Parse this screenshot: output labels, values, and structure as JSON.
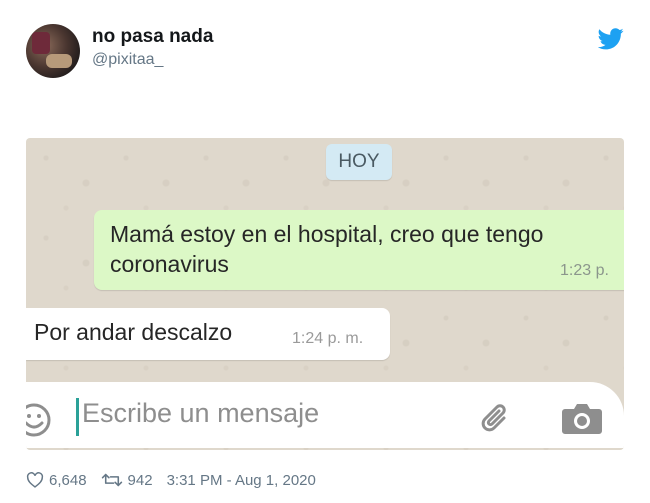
{
  "tweet": {
    "display_name": "no pasa nada",
    "handle": "@pixitaa_",
    "likes": "6,648",
    "retweets": "942",
    "timestamp": "3:31 PM - Aug 1, 2020"
  },
  "icons": {
    "brand": "twitter-bird-icon",
    "like": "heart-icon",
    "retweet": "retweet-icon"
  },
  "chat": {
    "date_chip": "HOY",
    "messages": [
      {
        "direction": "outgoing",
        "text": "Mamá estoy en el hospital, creo que tengo coronavirus",
        "time": "1:23 p."
      },
      {
        "direction": "incoming",
        "text": "Por andar descalzo",
        "time": "1:24 p. m."
      }
    ],
    "composer": {
      "placeholder": "Escribe un mensaje"
    }
  },
  "colors": {
    "twitter_blue": "#1da1f2",
    "outgoing_bubble": "#dcf8c6",
    "incoming_bubble": "#ffffff",
    "chat_background": "#dfd8cc",
    "date_chip": "#d4eaf4",
    "cursor": "#2aa198"
  }
}
